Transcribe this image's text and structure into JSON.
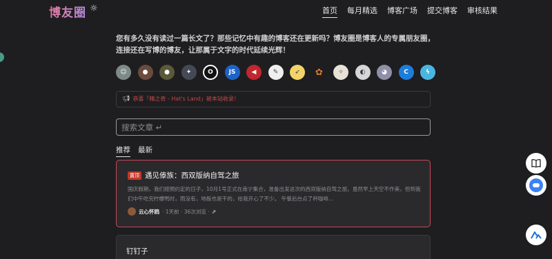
{
  "header": {
    "logo": "博友圈",
    "nav": [
      "首页",
      "每月精选",
      "博客广场",
      "提交博客",
      "审核结果"
    ],
    "active_nav": "首页"
  },
  "intro": {
    "text": "您有多久没有读过一篇长文了？那些记忆中有趣的博客还在更新吗？博友圈是博客人的专属朋友圈，连接还在写博的博友，让那属于文字的时代延续光辉！"
  },
  "avatars": [
    {
      "icon": "robot-avatar",
      "label": "",
      "color": "#7d8a86"
    },
    {
      "icon": "person-avatar",
      "label": "",
      "color": "#6b4b3e"
    },
    {
      "icon": "person-avatar",
      "label": "",
      "color": "#5a5a3a"
    },
    {
      "icon": "cartoon-avatar",
      "label": "",
      "color": "#444a55"
    },
    {
      "icon": "ring-avatar",
      "label": "O",
      "color": "#111111"
    },
    {
      "icon": "js-avatar",
      "label": "JS",
      "color": "#1d63c7"
    },
    {
      "icon": "arrow-avatar",
      "label": "◀",
      "color": "#c2262e"
    },
    {
      "icon": "sketch-avatar",
      "label": "",
      "color": "#efefef"
    },
    {
      "icon": "bird-avatar",
      "label": "",
      "color": "#f3d46a"
    },
    {
      "icon": "fox-avatar",
      "label": "",
      "color": "#e07a2a"
    },
    {
      "icon": "deer-avatar",
      "label": "",
      "color": "#e8e2d6"
    },
    {
      "icon": "cat-avatar",
      "label": "",
      "color": "#d6d6d6"
    },
    {
      "icon": "anime-avatar",
      "label": "",
      "color": "#8f8fa8"
    },
    {
      "icon": "c-avatar",
      "label": "C",
      "color": "#1d7dd8"
    },
    {
      "icon": "lightning-avatar",
      "label": "",
      "color": "#4ab6e0"
    }
  ],
  "notice": {
    "text": "恭喜「精之奇 - Hat's Land」被本站收录！"
  },
  "search": {
    "placeholder": "搜索文章 ↵"
  },
  "tabs": [
    "推荐",
    "最新"
  ],
  "active_tab": "推荐",
  "cards": [
    {
      "badge": "置顶",
      "title": "遇见傣族：西双版纳自驾之旅",
      "excerpt": "国庆假期，我们按照约定的日子，10月1号正式在南宁集合，准备出发这次的西双版纳自驾之旅。虽然早上天空不作美，但到我们中午吃完柠檬鸭时，雨没有，地板也是干的，给我开心了不少。 午餐后台点了杯咖啡...",
      "author": "云心怀鸥",
      "meta": "· 1天前 · 36次浏览 ·"
    },
    {
      "title": "钉钉子"
    }
  ],
  "colors": {
    "accent_border": "#c9485a",
    "notice_text": "#c44a4a",
    "background": "#1e1e20"
  }
}
